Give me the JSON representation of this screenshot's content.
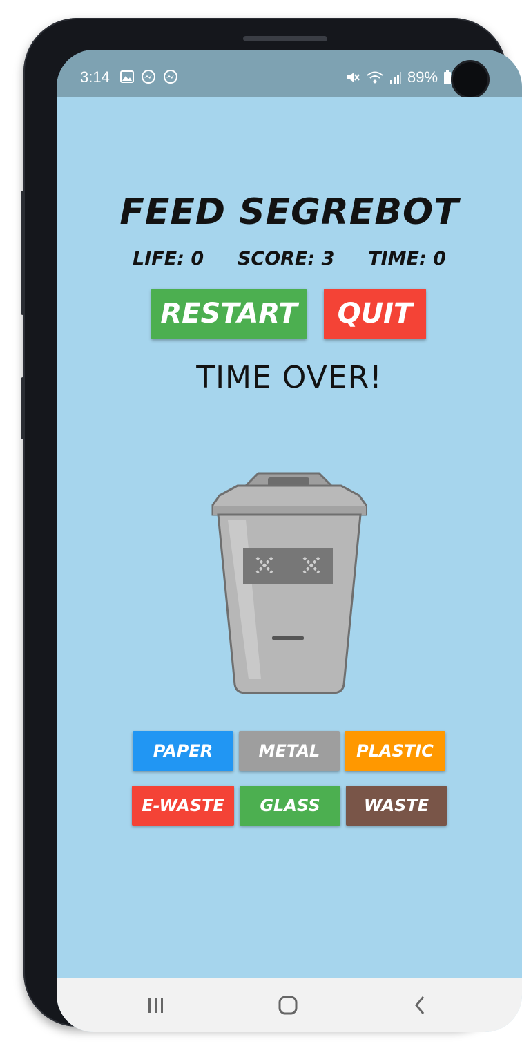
{
  "status_bar": {
    "time": "3:14",
    "battery": "89%",
    "left_icons": [
      "image-icon",
      "messenger-icon",
      "messenger-icon"
    ],
    "right_icons": [
      "mute-icon",
      "wifi-icon",
      "signal-icon",
      "battery-icon"
    ]
  },
  "game": {
    "title": "FEED SEGREBOT",
    "stats": {
      "life": "LIFE: 0",
      "score": "SCORE: 3",
      "time": "TIME: 0"
    },
    "restart_label": "RESTART",
    "quit_label": "QUIT",
    "message": "TIME OVER!",
    "character": "trash-bin-robot",
    "categories": [
      {
        "label": "PAPER",
        "color": "#2196f3"
      },
      {
        "label": "METAL",
        "color": "#9e9e9e"
      },
      {
        "label": "PLASTIC",
        "color": "#ff9800"
      },
      {
        "label": "E-WASTE",
        "color": "#f44336"
      },
      {
        "label": "GLASS",
        "color": "#4caf50"
      },
      {
        "label": "WASTE",
        "color": "#795548"
      }
    ]
  },
  "colors": {
    "background": "#a6d5ed",
    "restart": "#4caf50",
    "quit": "#f44336",
    "status_bar": "#7ea2b2"
  },
  "navigation": {
    "icons": [
      "recent-apps-icon",
      "home-icon",
      "back-icon"
    ]
  }
}
